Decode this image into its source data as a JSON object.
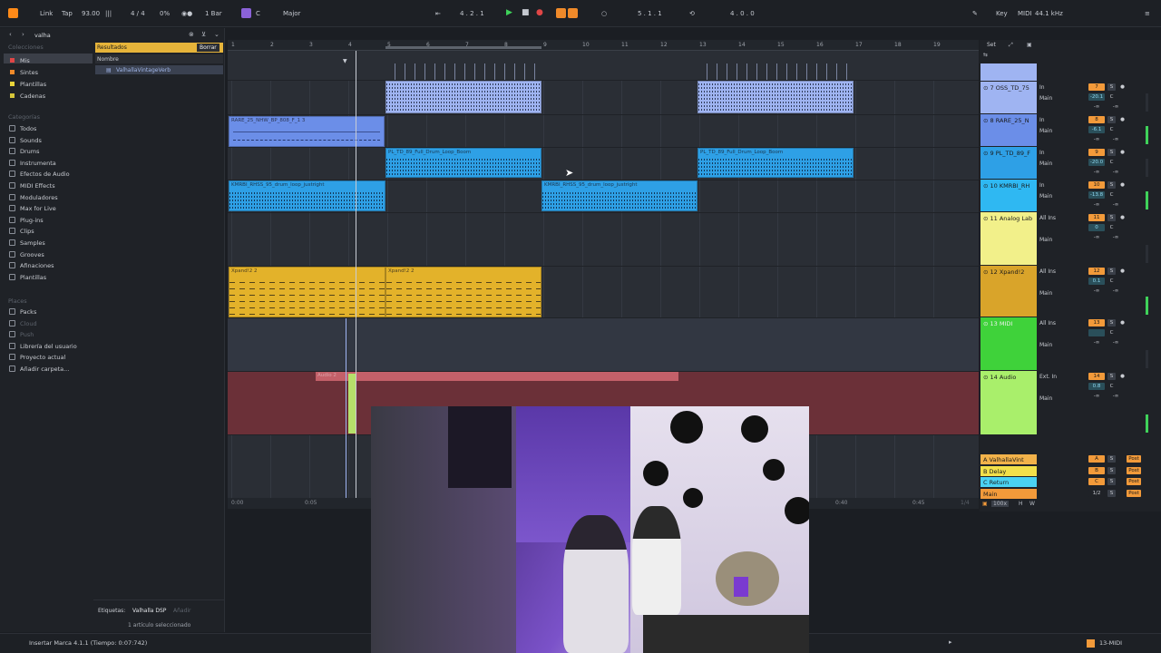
{
  "topbar": {
    "link": "Link",
    "tap": "Tap",
    "tempo": "93.00",
    "signature": "4 / 4",
    "cpu": "0%",
    "quantize": "1 Bar",
    "key": "C",
    "scale": "Major",
    "position": "4 .  2 .  1",
    "loop_start": "5 .  1 .  1",
    "loop_length": "4 .  0 .  0",
    "key_label": "Key",
    "midi_label": "MIDI",
    "sample_rate": "44.1 kHz"
  },
  "browser": {
    "search_value": "valha",
    "colecciones": "Colecciones",
    "collections": [
      {
        "label": "Mis",
        "color": "#e04646"
      },
      {
        "label": "Sintes",
        "color": "#f08a2a"
      },
      {
        "label": "Plantillas",
        "color": "#e8d43a"
      },
      {
        "label": "Cadenas",
        "color": "#d6c63a"
      }
    ],
    "categorias": "Categorías",
    "categories": [
      "Todos",
      "Sounds",
      "Drums",
      "Instrumenta",
      "Efectos de Audio",
      "MIDI Effects",
      "Moduladores",
      "Max for Live",
      "Plug-ins",
      "Clips",
      "Samples",
      "Grooves",
      "Afinaciones",
      "Plantillas"
    ],
    "places_label": "Places",
    "places": [
      "Packs",
      "Cloud",
      "Push",
      "Librería del usuario",
      "Proyecto actual",
      "Añadir carpeta..."
    ],
    "results_label": "Resultados",
    "clear_label": "Borrar",
    "name_header": "Nombre",
    "result_item": "ValhallaVintageVerb",
    "tags_label": "Etiquetas:",
    "tag_value": "Valhalla DSP",
    "tag_add": "Añadir",
    "selection_info": "1 artículo seleccionado"
  },
  "ruler": {
    "bars": [
      "1",
      "2",
      "3",
      "4",
      "5",
      "6",
      "7",
      "8",
      "9",
      "10",
      "11",
      "12",
      "13",
      "14",
      "15",
      "16",
      "17",
      "18",
      "19"
    ],
    "set_label": "Set"
  },
  "clips": [
    {
      "name": "RARE_25_NHW_BP_808_F_1 3",
      "color": "#6b8ee8"
    },
    {
      "name": "PL_TD_89_Full_Drum_Loop_Boom",
      "color": "#2ea0e6"
    },
    {
      "name": "PL_TD_89_Full_Drum_Loop_Boom",
      "color": "#2ea0e6"
    },
    {
      "name": "KMRBI_RHSS_95_drum_loop_justright",
      "color": "#2ea0e6"
    },
    {
      "name": "KMRBI_RHSS_95_drum_loop_justright",
      "color": "#2ea0e6"
    },
    {
      "name": "Xpand!2 2",
      "color": "#e3b22a"
    },
    {
      "name": "Xpand!2 2",
      "color": "#e3b22a"
    },
    {
      "name": "Audio 2",
      "color": "#b9464f"
    }
  ],
  "timeline": {
    "t0": "0:00",
    "t1": "0:05",
    "t2": "0:40",
    "t3": "0:45",
    "zoom": "1/4"
  },
  "tracks": [
    {
      "name": "7 OSS_TD_75",
      "color": "#9fb4f2",
      "num": "7",
      "vol": "-20.1"
    },
    {
      "name": "8 RARE_25_N",
      "color": "#6b8ee8",
      "num": "8",
      "vol": "-6.1"
    },
    {
      "name": "9 PL_TD_89_F",
      "color": "#2ea0e6",
      "num": "9",
      "vol": "-20.0"
    },
    {
      "name": "10 KMRBI_RH",
      "color": "#2fb8f2",
      "num": "10",
      "vol": "-13.8"
    },
    {
      "name": "11 Analog Lab",
      "color": "#f2f08a",
      "num": "11",
      "vol": "0"
    },
    {
      "name": "12 Xpand!2",
      "color": "#d9a42a",
      "num": "12",
      "vol": "0.1"
    },
    {
      "name": "13 MIDI",
      "color": "#3fd23a",
      "num": "13",
      "vol": ""
    },
    {
      "name": "14 Audio",
      "color": "#a9ef6b",
      "num": "14",
      "vol": "0.8"
    }
  ],
  "returns": [
    {
      "name": "A ValhallaVint",
      "color": "#f2b24a",
      "letter": "A"
    },
    {
      "name": "B Delay",
      "color": "#f2e04a",
      "letter": "B"
    },
    {
      "name": "C Return",
      "color": "#4ad2f2",
      "letter": "C"
    },
    {
      "name": "Main",
      "color": "#f29a3a",
      "letter": "1/2"
    }
  ],
  "mixer_labels": {
    "main": "Main",
    "auto": "Auto",
    "off": "Off",
    "in": "In",
    "all_ins": "All Ins",
    "all_channels": "All Channe",
    "no_output": "No Output",
    "ext_in": "Ext. In",
    "post": "Post",
    "s": "S",
    "c": "C",
    "inf": "-∞"
  },
  "footer_right": {
    "zoom_pct": "100x",
    "h": "H",
    "w": "W"
  },
  "status": {
    "message": "Insertar Marca 4.1.1 (Tiempo: 0:07:742)",
    "track": "13-MIDI"
  }
}
